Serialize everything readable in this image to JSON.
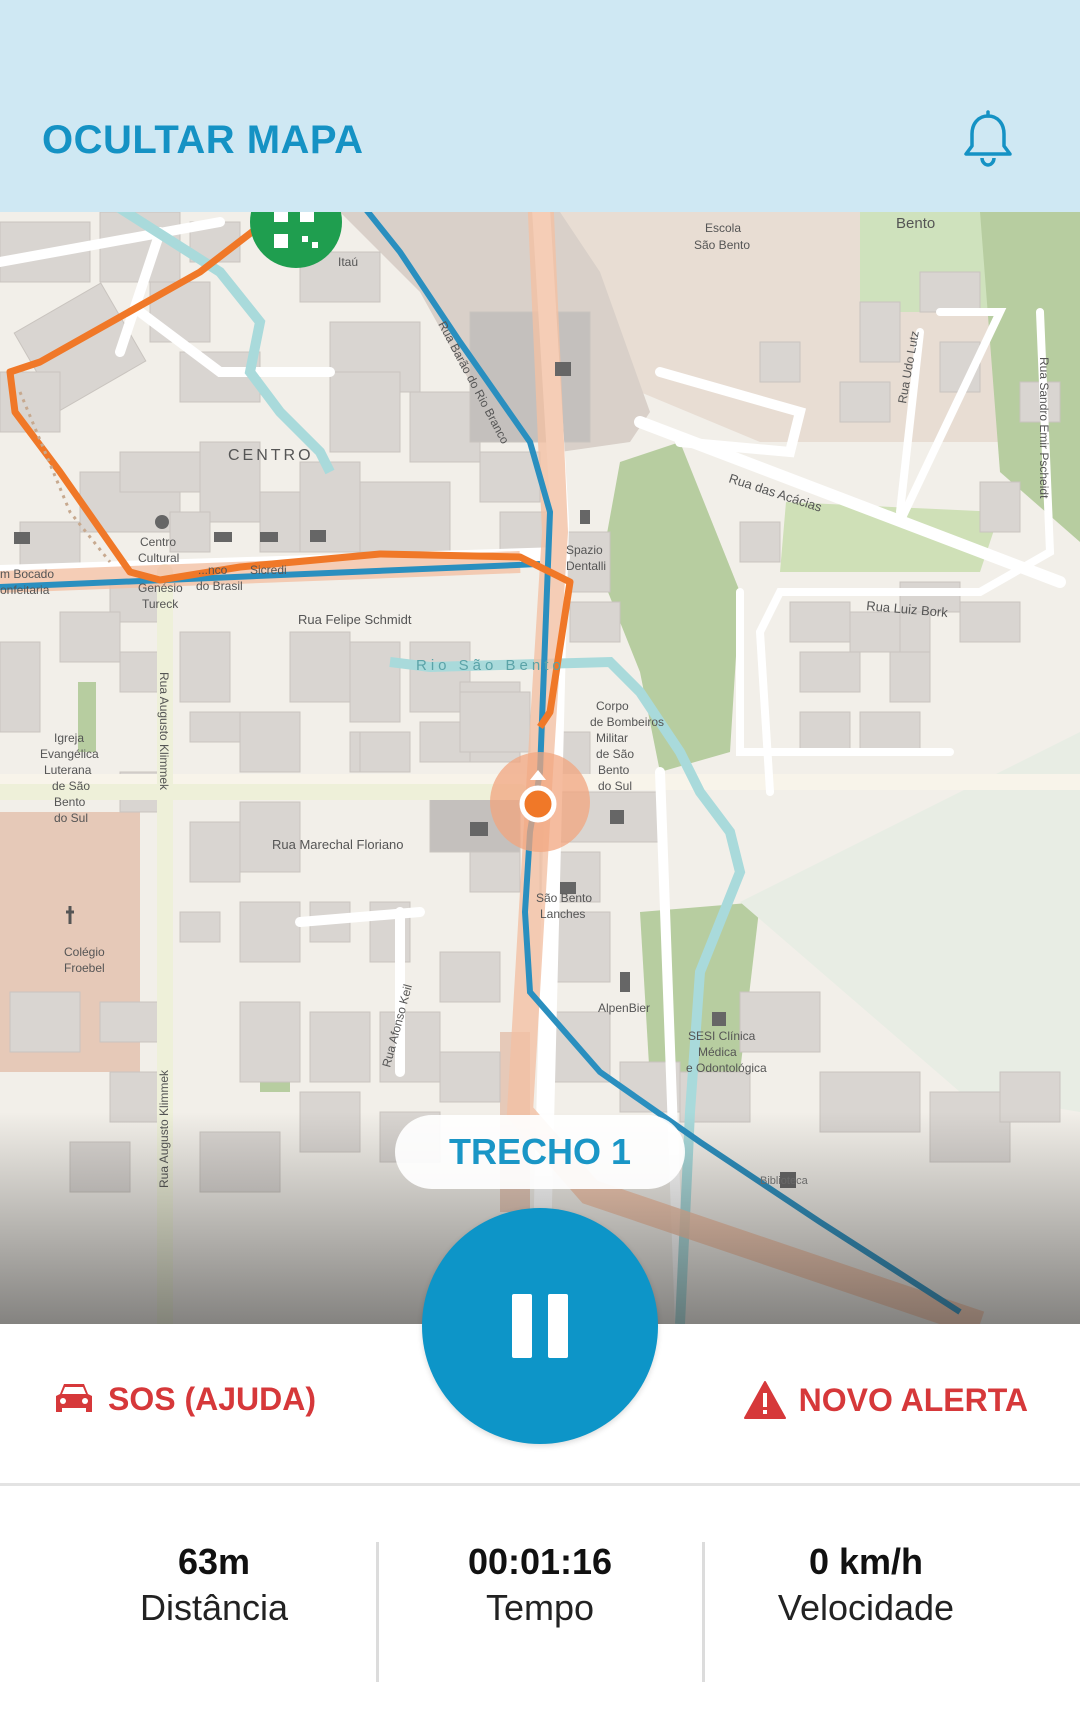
{
  "header": {
    "title": "OCULTAR MAPA",
    "bell_icon": "bell-icon"
  },
  "map": {
    "labels": {
      "centro": "CENTRO",
      "rua_barao": "Rua Barão do Rio Branco",
      "rua_udo_lutz": "Rua Udo Lutz",
      "rua_sandro": "Rua Sandro Emir Pscheidt",
      "rua_acacias": "Rua das Acácias",
      "rua_luiz_bork": "Rua Luiz Bork",
      "rua_felipe": "Rua Felipe Schmidt",
      "rio": "Rio São Bento",
      "rua_augusto": "Rua Augusto Klimmek",
      "rua_augusto2": "Rua Augusto Klimmek",
      "rua_marechal": "Rua Marechal Floriano",
      "rua_afonso": "Rua Afonso Keil",
      "escola_1": "Escola",
      "escola_2": "São Bento",
      "bento": "Bento",
      "itau": "Itaú",
      "spazio_1": "Spazio",
      "spazio_2": "Dentalli",
      "centro_cultural_1": "Centro",
      "centro_cultural_2": "Cultural",
      "genesio_1": "Genésio",
      "genesio_2": "Tureck",
      "banco_1": "...nco",
      "banco_2": "do Brasil",
      "sicredi": "Sicredi",
      "bocado_1": "m Bocado",
      "bocado_2": "onfeitaria",
      "igreja_1": "Igreja",
      "igreja_2": "Evangélica",
      "igreja_3": "Luterana",
      "igreja_4": "de São",
      "igreja_5": "Bento",
      "igreja_6": "do Sul",
      "bombeiros_1": "Corpo",
      "bombeiros_2": "de Bombeiros",
      "bombeiros_3": "Militar",
      "bombeiros_4": "de São",
      "bombeiros_5": "Bento",
      "bombeiros_6": "do Sul",
      "lanches_1": "São Bento",
      "lanches_2": "Lanches",
      "colegio_1": "Colégio",
      "colegio_2": "Froebel",
      "alpenbier": "AlpenBier",
      "sesi_1": "SESI Clínica",
      "sesi_2": "Médica",
      "sesi_3": "e Odontológica",
      "biblioteca": "Biblioteca"
    }
  },
  "segment": {
    "label": "TRECHO 1"
  },
  "actions": {
    "sos_label": "SOS (AJUDA)",
    "alert_label": "NOVO ALERTA"
  },
  "stats": [
    {
      "value": "63m",
      "label": "Distância"
    },
    {
      "value": "00:01:16",
      "label": "Tempo"
    },
    {
      "value": "0 km/h",
      "label": "Velocidade"
    }
  ],
  "colors": {
    "header_bg": "#cfe8f3",
    "accent": "#0d95c8",
    "route_orange": "#f07828",
    "route_blue": "#2a8fbf",
    "danger": "#d6383a"
  }
}
